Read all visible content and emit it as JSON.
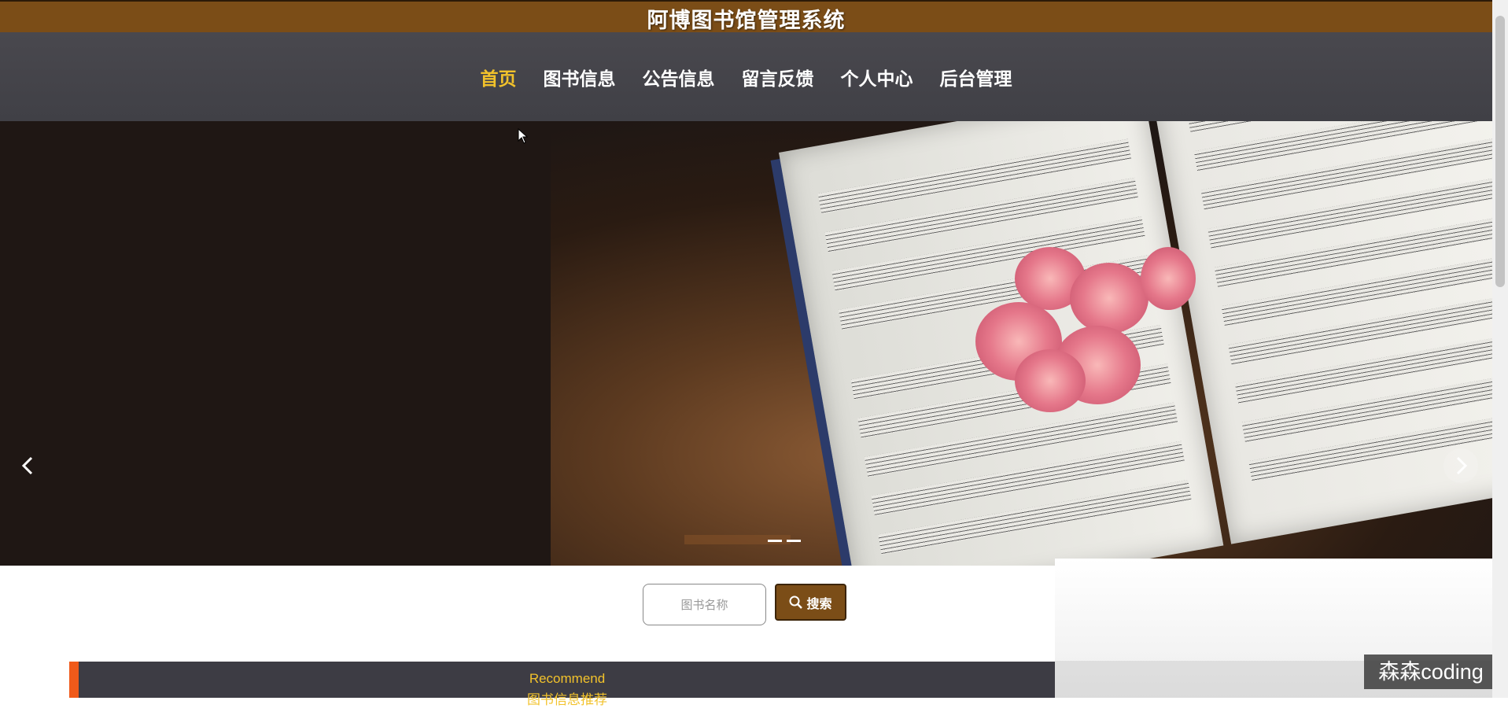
{
  "header": {
    "title": "阿博图书馆管理系统"
  },
  "nav": {
    "items": [
      {
        "label": "首页",
        "active": true
      },
      {
        "label": "图书信息"
      },
      {
        "label": "公告信息"
      },
      {
        "label": "留言反馈"
      },
      {
        "label": "个人中心"
      },
      {
        "label": "后台管理"
      }
    ]
  },
  "carousel": {
    "prev_icon": "chevron-left-icon",
    "next_icon": "chevron-right-icon",
    "slide_count": 3,
    "active_index": 0
  },
  "search": {
    "placeholder": "图书名称",
    "button_label": "搜索",
    "icon": "search-icon"
  },
  "recommend": {
    "title_en": "Recommend",
    "title_cn": "图书信息推荐"
  },
  "watermark": "森森coding",
  "colors": {
    "brand": "#7b4d17",
    "nav_bg": "#444349",
    "accent": "#f2c22b",
    "recommend_border": "#f05a1a"
  }
}
